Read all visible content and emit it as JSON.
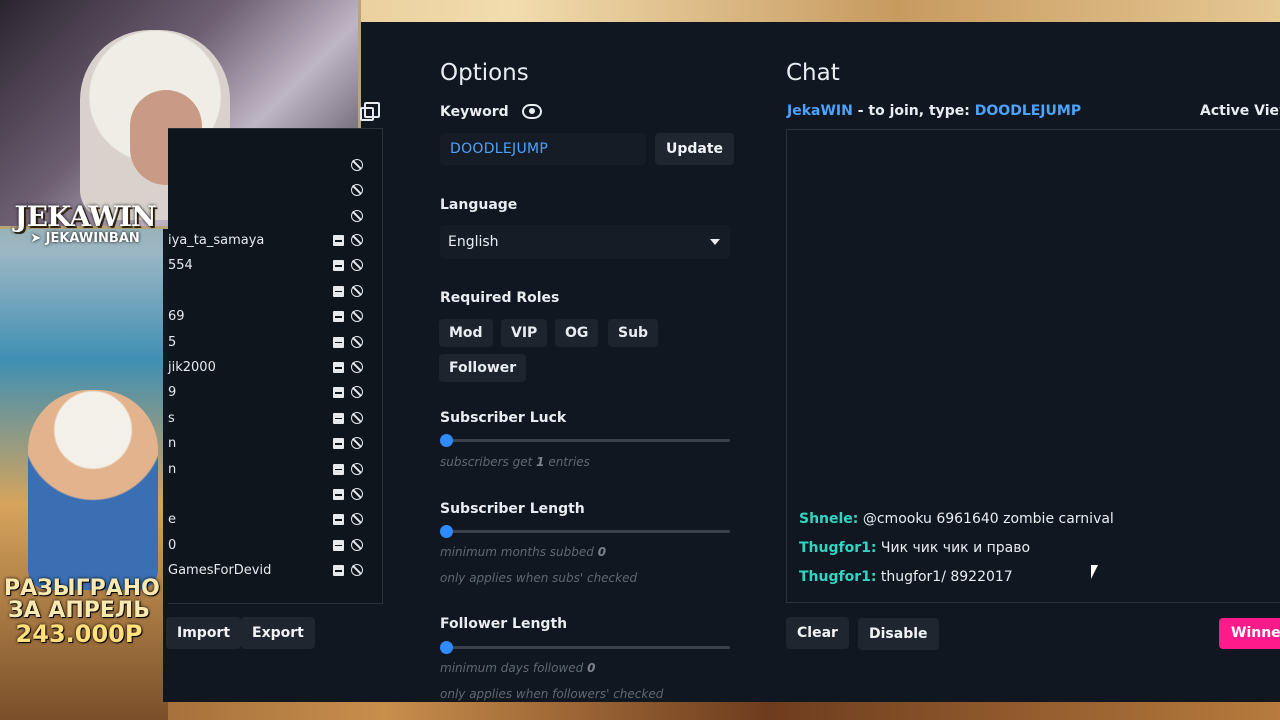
{
  "overlay": {
    "brand": "JEKAWIN",
    "brand_sub": "JEKAWINBAN",
    "promo_line1": "РАЗЫГРАНО",
    "promo_line2": "ЗА АПРЕЛЬ",
    "promo_amount": "243.000Р"
  },
  "participants": {
    "names": [
      "iya_ta_samaya",
      "554",
      "",
      "69",
      "5",
      "jik2000",
      "9",
      "s",
      "n",
      "n",
      "",
      "e",
      "0",
      "GamesForDevid"
    ],
    "import_label": "Import",
    "export_label": "Export"
  },
  "options": {
    "title": "Options",
    "keyword_label": "Keyword",
    "keyword_value": "DOODLEJUMP",
    "update_label": "Update",
    "language_label": "Language",
    "language_value": "English",
    "roles_label": "Required Roles",
    "roles": [
      "Mod",
      "VIP",
      "OG",
      "Sub",
      "Follower"
    ],
    "sub_luck_label": "Subscriber Luck",
    "sub_luck_hint_pre": "subscribers get",
    "sub_luck_value": "1",
    "sub_luck_hint_post": "entries",
    "sub_length_label": "Subscriber Length",
    "sub_length_hint_pre": "minimum months subbed",
    "sub_length_value": "0",
    "sub_length_note": "only applies when subs' checked",
    "follower_length_label": "Follower Length",
    "follower_length_hint_pre": "minimum days followed",
    "follower_length_value": "0",
    "follower_length_note": "only applies when followers' checked"
  },
  "chat": {
    "title": "Chat",
    "channel": "JekaWIN",
    "join_text": " - to join, type: ",
    "join_keyword": "DOODLEJUMP",
    "active_viewers": "Active View",
    "messages": [
      {
        "user": "Shnele:",
        "text": " @cmooku 6961640 zombie carnival"
      },
      {
        "user": "Thugfor1:",
        "text": " Чик чик чик и право"
      },
      {
        "user": "Thugfor1:",
        "text": " thugfor1/ 8922017"
      }
    ],
    "clear_label": "Clear",
    "disable_label": "Disable",
    "winner_label": "Winner"
  },
  "colors": {
    "accent_blue": "#4ea3ff",
    "chat_user": "#2fd6c3",
    "winner_pink": "#ff1a8c",
    "panel_bg": "#101720"
  }
}
